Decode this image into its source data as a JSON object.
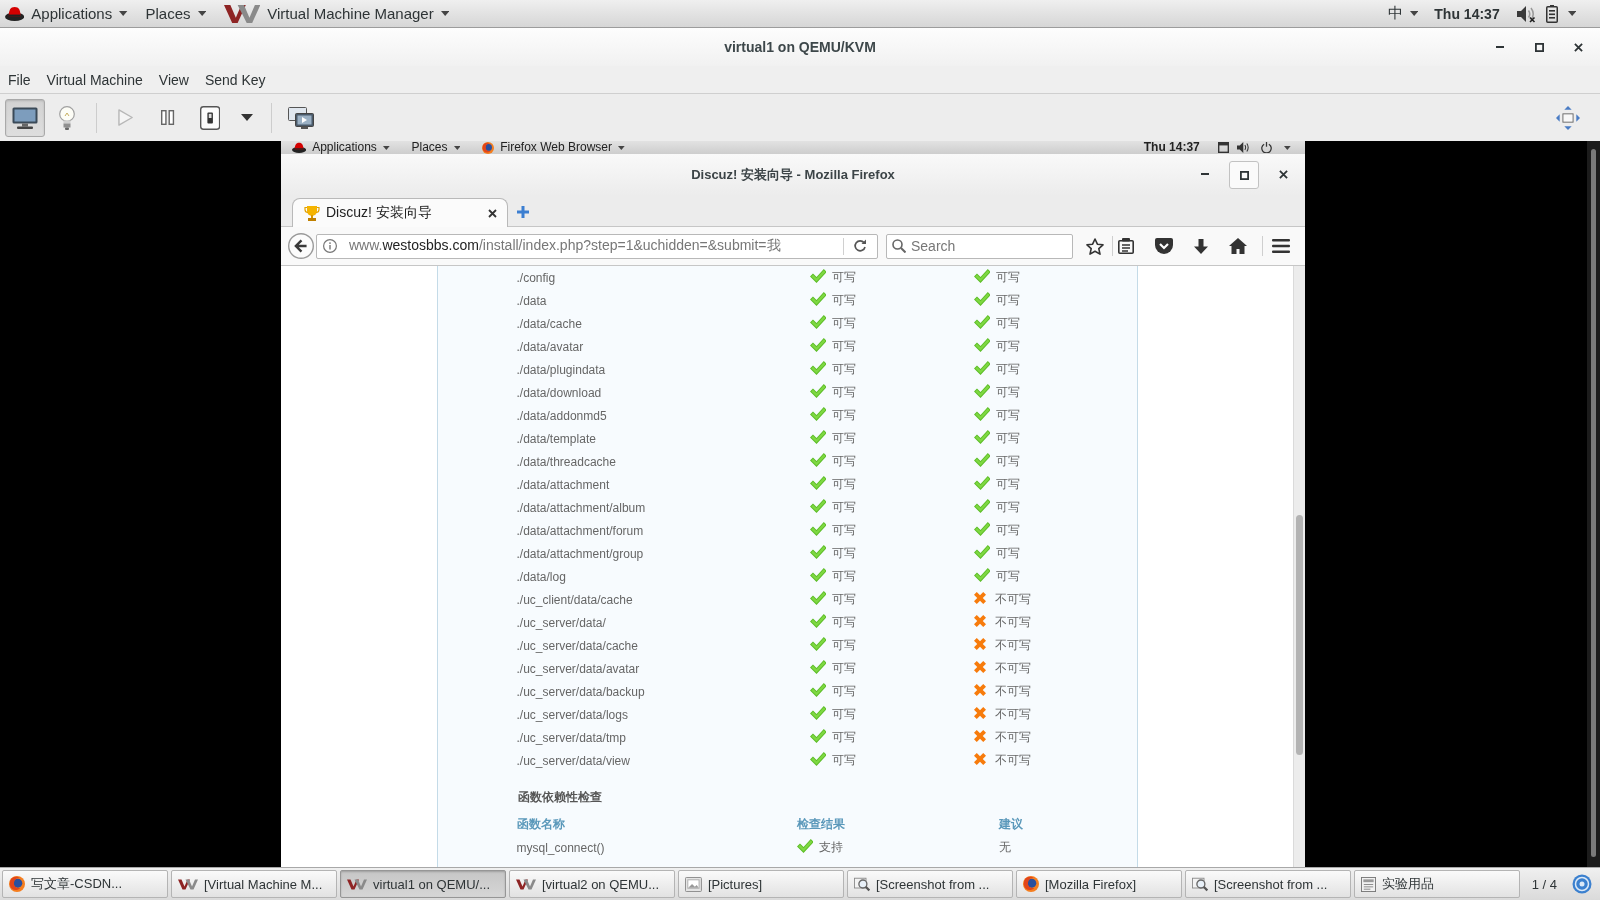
{
  "top_panel": {
    "menus": [
      {
        "label": "Applications",
        "kind": "hat"
      },
      {
        "label": "Places",
        "kind": "plain"
      },
      {
        "label": "Virtual Machine Manager",
        "kind": "logo"
      }
    ],
    "input_method": "中",
    "clock": "Thu 14:37"
  },
  "vm_window": {
    "title": "virtual1 on QEMU/KVM",
    "menu": [
      "File",
      "Virtual Machine",
      "View",
      "Send Key"
    ],
    "toolbar": {
      "view_buttons": [
        {
          "kind": "monitor",
          "selected": true
        },
        {
          "kind": "bulb",
          "selected": false
        }
      ],
      "power_buttons": [
        {
          "kind": "play",
          "disabled": true
        },
        {
          "kind": "pause",
          "disabled": false
        },
        {
          "kind": "power",
          "disabled": false
        },
        {
          "kind": "caret",
          "disabled": false
        }
      ],
      "extra_buttons": [
        {
          "kind": "screens"
        }
      ]
    }
  },
  "guest_panel": {
    "menus": [
      {
        "label": "Applications",
        "kind": "hat"
      },
      {
        "label": "Places",
        "kind": "plain"
      },
      {
        "label": "Firefox Web Browser",
        "kind": "firefox"
      }
    ],
    "clock": "Thu 14:37"
  },
  "browser": {
    "title": "Discuz! 安装向导 - Mozilla Firefox",
    "tabs": [
      {
        "label": "Discuz! 安装向导",
        "selected": true
      }
    ],
    "url": "www.**westosbbs.com**/install/index.php?step=1&uchidden=&submit=我",
    "search": {
      "placeholder": "Search"
    }
  },
  "page": {
    "directory_rows": [
      {
        "path": "./config",
        "column_2": {
          "ok": true,
          "text": "可写"
        },
        "column_3": {
          "ok": true,
          "text": "可写"
        }
      },
      {
        "path": "./data",
        "column_2": {
          "ok": true,
          "text": "可写"
        },
        "column_3": {
          "ok": true,
          "text": "可写"
        }
      },
      {
        "path": "./data/cache",
        "column_2": {
          "ok": true,
          "text": "可写"
        },
        "column_3": {
          "ok": true,
          "text": "可写"
        }
      },
      {
        "path": "./data/avatar",
        "column_2": {
          "ok": true,
          "text": "可写"
        },
        "column_3": {
          "ok": true,
          "text": "可写"
        }
      },
      {
        "path": "./data/plugindata",
        "column_2": {
          "ok": true,
          "text": "可写"
        },
        "column_3": {
          "ok": true,
          "text": "可写"
        }
      },
      {
        "path": "./data/download",
        "column_2": {
          "ok": true,
          "text": "可写"
        },
        "column_3": {
          "ok": true,
          "text": "可写"
        }
      },
      {
        "path": "./data/addonmd5",
        "column_2": {
          "ok": true,
          "text": "可写"
        },
        "column_3": {
          "ok": true,
          "text": "可写"
        }
      },
      {
        "path": "./data/template",
        "column_2": {
          "ok": true,
          "text": "可写"
        },
        "column_3": {
          "ok": true,
          "text": "可写"
        }
      },
      {
        "path": "./data/threadcache",
        "column_2": {
          "ok": true,
          "text": "可写"
        },
        "column_3": {
          "ok": true,
          "text": "可写"
        }
      },
      {
        "path": "./data/attachment",
        "column_2": {
          "ok": true,
          "text": "可写"
        },
        "column_3": {
          "ok": true,
          "text": "可写"
        }
      },
      {
        "path": "./data/attachment/album",
        "column_2": {
          "ok": true,
          "text": "可写"
        },
        "column_3": {
          "ok": true,
          "text": "可写"
        }
      },
      {
        "path": "./data/attachment/forum",
        "column_2": {
          "ok": true,
          "text": "可写"
        },
        "column_3": {
          "ok": true,
          "text": "可写"
        }
      },
      {
        "path": "./data/attachment/group",
        "column_2": {
          "ok": true,
          "text": "可写"
        },
        "column_3": {
          "ok": true,
          "text": "可写"
        }
      },
      {
        "path": "./data/log",
        "column_2": {
          "ok": true,
          "text": "可写"
        },
        "column_3": {
          "ok": true,
          "text": "可写"
        }
      },
      {
        "path": "./uc_client/data/cache",
        "column_2": {
          "ok": true,
          "text": "可写"
        },
        "column_3": {
          "ok": false,
          "text": "不可写"
        }
      },
      {
        "path": "./uc_server/data/",
        "column_2": {
          "ok": true,
          "text": "可写"
        },
        "column_3": {
          "ok": false,
          "text": "不可写"
        }
      },
      {
        "path": "./uc_server/data/cache",
        "column_2": {
          "ok": true,
          "text": "可写"
        },
        "column_3": {
          "ok": false,
          "text": "不可写"
        }
      },
      {
        "path": "./uc_server/data/avatar",
        "column_2": {
          "ok": true,
          "text": "可写"
        },
        "column_3": {
          "ok": false,
          "text": "不可写"
        }
      },
      {
        "path": "./uc_server/data/backup",
        "column_2": {
          "ok": true,
          "text": "可写"
        },
        "column_3": {
          "ok": false,
          "text": "不可写"
        }
      },
      {
        "path": "./uc_server/data/logs",
        "column_2": {
          "ok": true,
          "text": "可写"
        },
        "column_3": {
          "ok": false,
          "text": "不可写"
        }
      },
      {
        "path": "./uc_server/data/tmp",
        "column_2": {
          "ok": true,
          "text": "可写"
        },
        "column_3": {
          "ok": false,
          "text": "不可写"
        }
      },
      {
        "path": "./uc_server/data/view",
        "column_2": {
          "ok": true,
          "text": "可写"
        },
        "column_3": {
          "ok": false,
          "text": "不可写"
        }
      }
    ],
    "function_check": {
      "title": "函数依赖性检查",
      "columns": [
        "函数名称",
        "检查结果",
        "建议"
      ],
      "rows": [
        {
          "name": "mysql_connect()",
          "result": {
            "ok": true,
            "text": "支持"
          },
          "advice": "无"
        }
      ]
    }
  },
  "taskbar": {
    "items": [
      {
        "label": "写文章-CSDN...",
        "kind": "firefox",
        "selected": false
      },
      {
        "label": "[Virtual Machine M...",
        "kind": "logo",
        "selected": false
      },
      {
        "label": "virtual1 on QEMU/...",
        "kind": "logo",
        "selected": true
      },
      {
        "label": "[virtual2 on QEMU...",
        "kind": "logo",
        "selected": false
      },
      {
        "label": "[Pictures]",
        "kind": "pictures",
        "selected": false
      },
      {
        "label": "[Screenshot from ...",
        "kind": "screenshot",
        "selected": false
      },
      {
        "label": "[Mozilla Firefox]",
        "kind": "firefox",
        "selected": false
      },
      {
        "label": "[Screenshot from ...",
        "kind": "screenshot",
        "selected": false
      },
      {
        "label": "实验用品",
        "kind": "document",
        "selected": false
      }
    ],
    "workspace": "1 / 4"
  }
}
